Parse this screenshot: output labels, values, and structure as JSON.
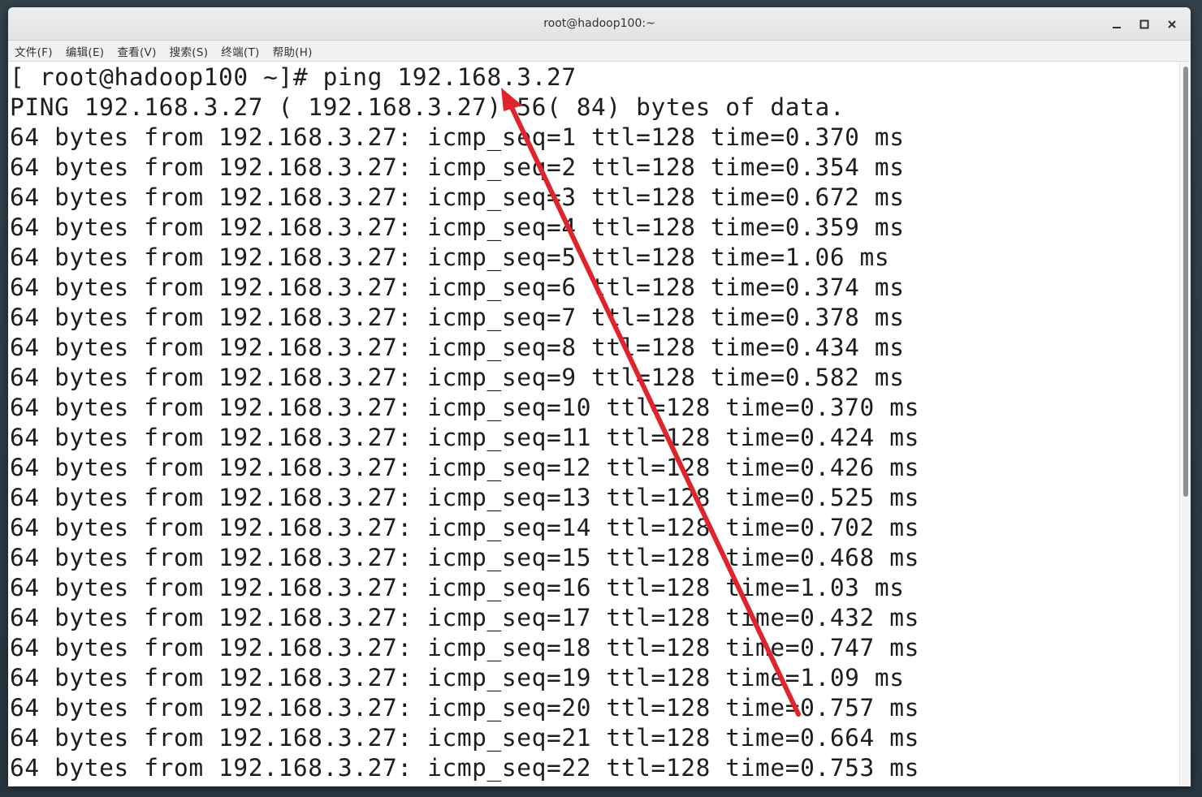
{
  "window": {
    "title": "root@hadoop100:~",
    "controls": {
      "minimize": "minimize-icon",
      "maximize": "maximize-icon",
      "close": "close-icon"
    }
  },
  "menubar": {
    "items": [
      {
        "label": "文件(F)"
      },
      {
        "label": "编辑(E)"
      },
      {
        "label": "查看(V)"
      },
      {
        "label": "搜索(S)"
      },
      {
        "label": "终端(T)"
      },
      {
        "label": "帮助(H)"
      }
    ]
  },
  "terminal": {
    "lines": [
      "[ root@hadoop100 ~]# ping 192.168.3.27",
      "PING 192.168.3.27 ( 192.168.3.27) 56( 84) bytes of data.",
      "64 bytes from 192.168.3.27: icmp_seq=1 ttl=128 time=0.370 ms",
      "64 bytes from 192.168.3.27: icmp_seq=2 ttl=128 time=0.354 ms",
      "64 bytes from 192.168.3.27: icmp_seq=3 ttl=128 time=0.672 ms",
      "64 bytes from 192.168.3.27: icmp_seq=4 ttl=128 time=0.359 ms",
      "64 bytes from 192.168.3.27: icmp_seq=5 ttl=128 time=1.06 ms",
      "64 bytes from 192.168.3.27: icmp_seq=6 ttl=128 time=0.374 ms",
      "64 bytes from 192.168.3.27: icmp_seq=7 ttl=128 time=0.378 ms",
      "64 bytes from 192.168.3.27: icmp_seq=8 ttl=128 time=0.434 ms",
      "64 bytes from 192.168.3.27: icmp_seq=9 ttl=128 time=0.582 ms",
      "64 bytes from 192.168.3.27: icmp_seq=10 ttl=128 time=0.370 ms",
      "64 bytes from 192.168.3.27: icmp_seq=11 ttl=128 time=0.424 ms",
      "64 bytes from 192.168.3.27: icmp_seq=12 ttl=128 time=0.426 ms",
      "64 bytes from 192.168.3.27: icmp_seq=13 ttl=128 time=0.525 ms",
      "64 bytes from 192.168.3.27: icmp_seq=14 ttl=128 time=0.702 ms",
      "64 bytes from 192.168.3.27: icmp_seq=15 ttl=128 time=0.468 ms",
      "64 bytes from 192.168.3.27: icmp_seq=16 ttl=128 time=1.03 ms",
      "64 bytes from 192.168.3.27: icmp_seq=17 ttl=128 time=0.432 ms",
      "64 bytes from 192.168.3.27: icmp_seq=18 ttl=128 time=0.747 ms",
      "64 bytes from 192.168.3.27: icmp_seq=19 ttl=128 time=1.09 ms",
      "64 bytes from 192.168.3.27: icmp_seq=20 ttl=128 time=0.757 ms",
      "64 bytes from 192.168.3.27: icmp_seq=21 ttl=128 time=0.664 ms",
      "64 bytes from 192.168.3.27: icmp_seq=22 ttl=128 time=0.753 ms"
    ]
  },
  "annotation": {
    "color": "#e0242b",
    "icon": "red-arrow-annotation"
  }
}
